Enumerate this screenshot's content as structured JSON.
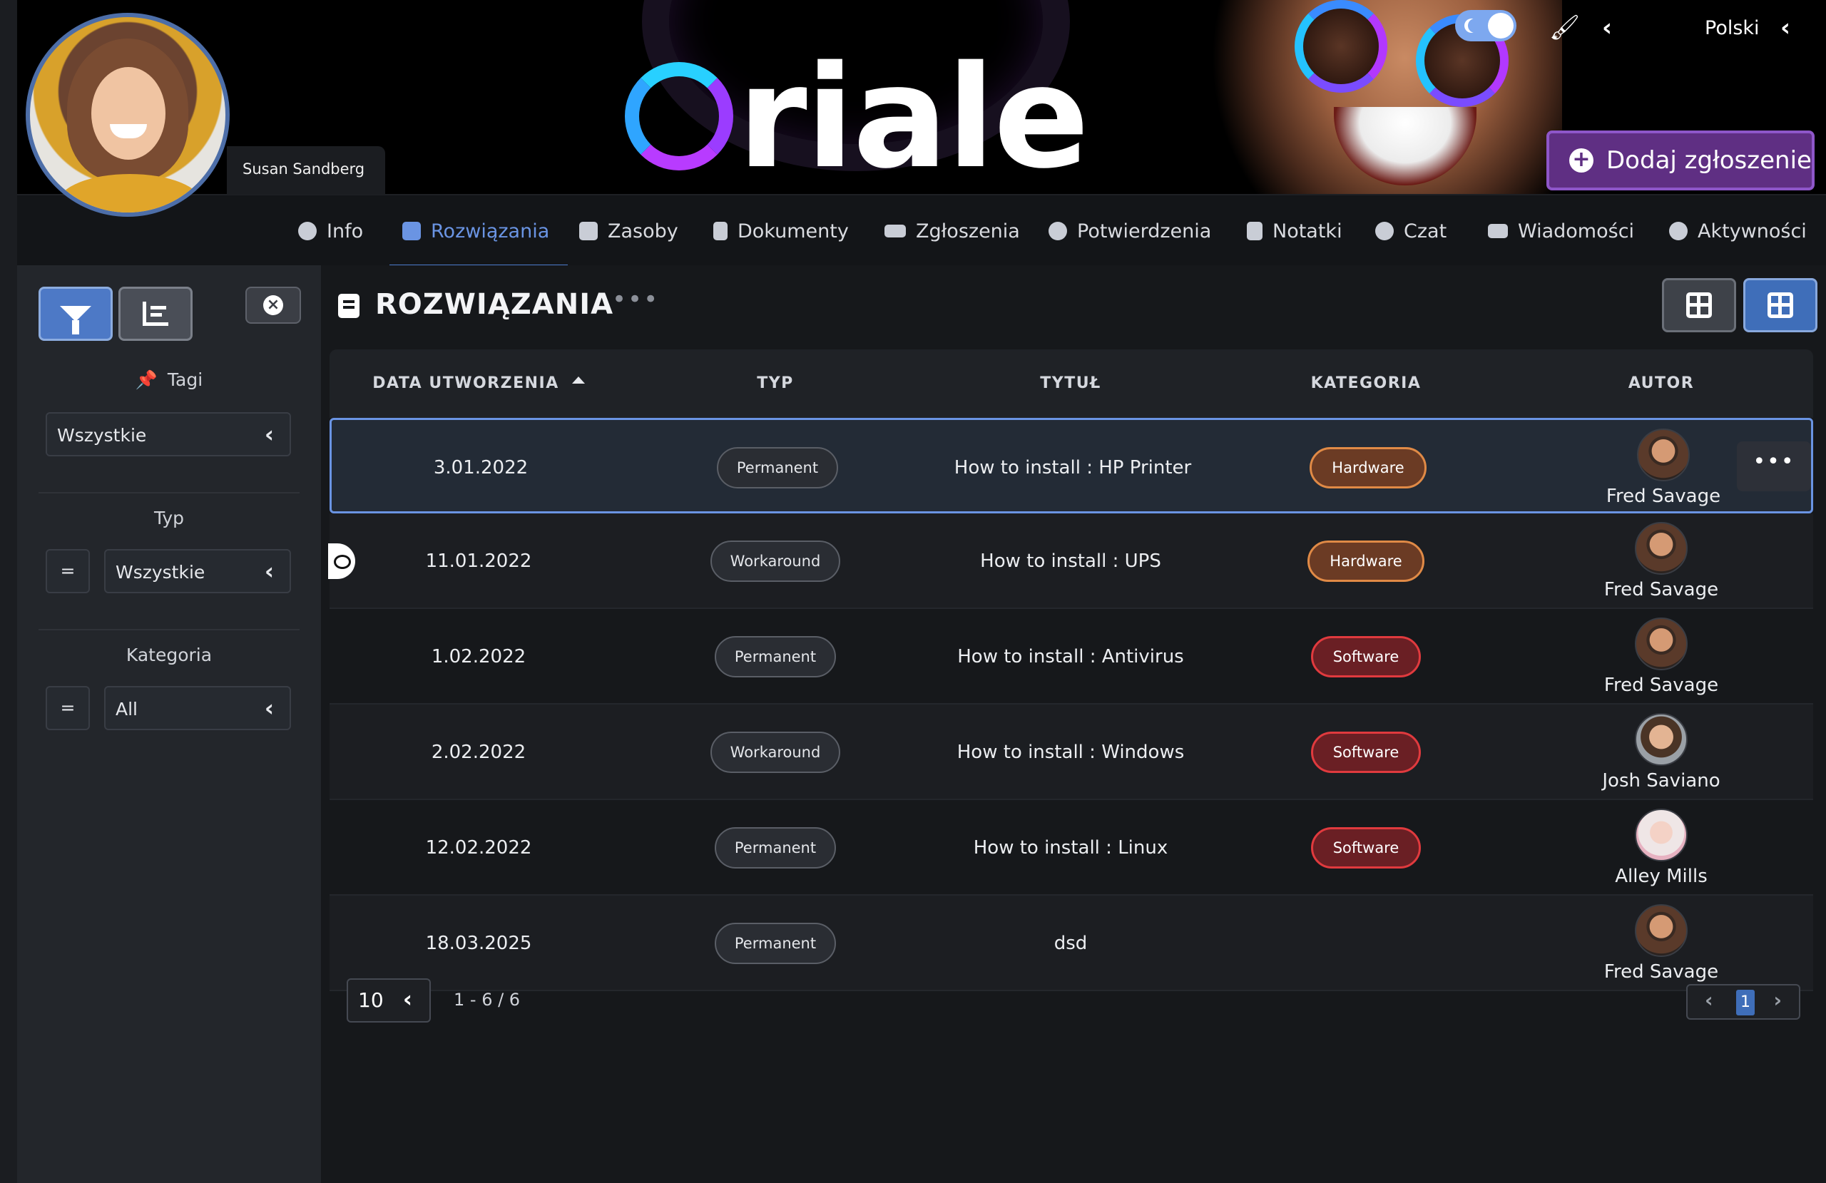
{
  "header": {
    "user_name": "Susan Sandberg",
    "logo_text": "riale",
    "language": "Polski",
    "add_button_label": "Dodaj zgłoszenie"
  },
  "nav": {
    "tabs": [
      {
        "label": "Info",
        "icon": "info-icon"
      },
      {
        "label": "Rozwiązania",
        "icon": "book-icon",
        "active": true
      },
      {
        "label": "Zasoby",
        "icon": "cubes-icon"
      },
      {
        "label": "Dokumenty",
        "icon": "document-icon"
      },
      {
        "label": "Zgłoszenia",
        "icon": "ticket-icon"
      },
      {
        "label": "Potwierdzenia",
        "icon": "user-check-icon"
      },
      {
        "label": "Notatki",
        "icon": "note-icon"
      },
      {
        "label": "Czat",
        "icon": "chat-icon"
      },
      {
        "label": "Wiadomości",
        "icon": "envelope-icon"
      },
      {
        "label": "Aktywności",
        "icon": "history-icon"
      }
    ]
  },
  "sidebar": {
    "tags_label": "Tagi",
    "tags_value": "Wszystkie",
    "type_label": "Typ",
    "type_operator": "=",
    "type_value": "Wszystkie",
    "category_label": "Kategoria",
    "category_operator": "=",
    "category_value": "All"
  },
  "main": {
    "title": "ROZWIĄZANIA",
    "more": "•••",
    "columns": {
      "date": "DATA UTWORZENIA",
      "type": "TYP",
      "title": "TYTUŁ",
      "category": "KATEGORIA",
      "author": "AUTOR"
    },
    "rows": [
      {
        "date": "3.01.2022",
        "type": "Permanent",
        "title": "How to install : HP Printer",
        "category": "Hardware",
        "author": "Fred Savage"
      },
      {
        "date": "11.01.2022",
        "type": "Workaround",
        "title": "How to install : UPS",
        "category": "Hardware",
        "author": "Fred Savage"
      },
      {
        "date": "1.02.2022",
        "type": "Permanent",
        "title": "How to install : Antivirus",
        "category": "Software",
        "author": "Fred Savage"
      },
      {
        "date": "2.02.2022",
        "type": "Workaround",
        "title": "How to install : Windows",
        "category": "Software",
        "author": "Josh Saviano"
      },
      {
        "date": "12.02.2022",
        "type": "Permanent",
        "title": "How to install : Linux",
        "category": "Software",
        "author": "Alley Mills"
      },
      {
        "date": "18.03.2025",
        "type": "Permanent",
        "title": "dsd",
        "category": "",
        "author": "Fred Savage"
      }
    ],
    "row_more": "•••",
    "page_size": "10",
    "range_info": "1 - 6 / 6",
    "current_page": "1"
  },
  "colors": {
    "accent": "#4d7ccd",
    "hardware": "#e08a46",
    "software": "#e03a3e",
    "add_button": "#5f2f83"
  }
}
